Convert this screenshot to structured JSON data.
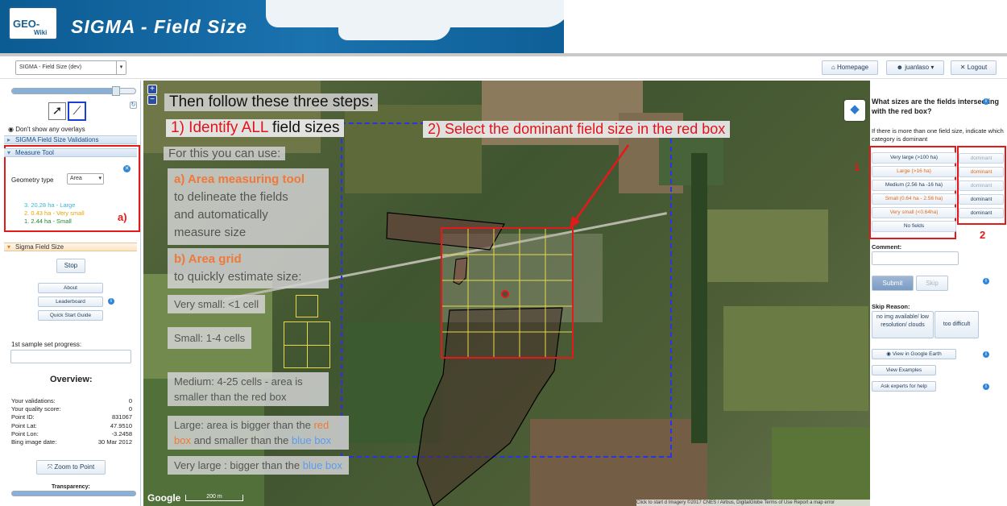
{
  "header": {
    "logo_top": "GEO-",
    "logo_bottom": "Wiki",
    "title": "SIGMA - Field Size"
  },
  "toolbar": {
    "project_select": "SIGMA - Field Size (dev)",
    "homepage": "Homepage",
    "user": "juanlaso",
    "logout": "Logout"
  },
  "left": {
    "overlay_option": "Don't show any overlays",
    "validations_header": "SIGMA Field Size Validations",
    "measure_header": "Measure Tool",
    "geometry_label": "Geometry type",
    "geometry_value": "Area",
    "measurements": [
      {
        "text": "3. 20.28 ha - Large",
        "color": "#35b5d8"
      },
      {
        "text": "2. 0.43 ha - Very small",
        "color": "#e7a300"
      },
      {
        "text": "1. 2.44 ha - Small",
        "color": "#1e8a2a"
      }
    ],
    "annot_a": "a)",
    "sigma_header": "Sigma Field Size",
    "stop": "Stop",
    "about": "About",
    "leaderboard": "Leaderboard",
    "quickstart": "Quick Start Guide",
    "progress_label": "1st sample set progress:",
    "overview_title": "Overview:",
    "stats": [
      {
        "k": "Your validations:",
        "v": "0"
      },
      {
        "k": "Your quality score:",
        "v": "0"
      },
      {
        "k": "Point ID:",
        "v": "831067"
      },
      {
        "k": "Point Lat:",
        "v": "47.9510"
      },
      {
        "k": "Point Lon:",
        "v": "-3.2458"
      },
      {
        "k": "Bing image date:",
        "v": "30 Mar 2012"
      }
    ],
    "zoom_btn": "Zoom to Point",
    "transparency": "Transparency:"
  },
  "map": {
    "step_title": "Then follow these three steps:",
    "step1_pre": "1) Identify ",
    "step1_hl": "ALL",
    "step1_post": " field sizes",
    "step2_pre": "2) Select the dominant field size in the ",
    "step2_hl": "red box",
    "use_label": "For this you can use:",
    "tool_a_title": "a) Area measuring tool",
    "tool_a_text1": "to delineate the fields",
    "tool_a_text2": "and automatically",
    "tool_a_text3": "measure size",
    "tool_b_title": "b) Area grid",
    "tool_b_text": "to quickly estimate size:",
    "vsmall": "Very small: <1  cell",
    "small": "Small: 1-4 cells",
    "medium1": "Medium:  4-25 cells - area is",
    "medium2": "smaller than the red box",
    "large_pre": "Large: area is bigger than the ",
    "large_red": "red",
    "large_red2": "box",
    "large_mid": " and smaller than the ",
    "large_blue": "blue box",
    "vlarge_pre": "Very large : bigger than the ",
    "vlarge_blue": "blue box",
    "google": "Google",
    "scale": "200 m",
    "footer_click": "Click to start d",
    "footer_imagery": "Imagery ©2017 CNES / Airbus, DigitalGlobe",
    "footer_terms": "Terms of Use",
    "footer_report": "Report a map error"
  },
  "right": {
    "question": "What sizes are the fields intersecting with the red box?",
    "hint": "If there is more than one field size, indicate which category is dominant",
    "categories": [
      {
        "label": "Very large (>100 ha)",
        "color": "#1f3b5a"
      },
      {
        "label": "Large (>16 ha)",
        "color": "#e06a1c"
      },
      {
        "label": "Medium (2.56 ha -16 ha)",
        "color": "#1f3b5a"
      },
      {
        "label": "Small (0.64 ha - 2.56 ha)",
        "color": "#e06a1c"
      },
      {
        "label": "Very small (<0.64ha)",
        "color": "#e06a1c"
      },
      {
        "label": "No fields",
        "color": "#1f3b5a"
      }
    ],
    "dominant": [
      {
        "label": "dominant",
        "color": "#9aaabb"
      },
      {
        "label": "dominant",
        "color": "#e06a1c"
      },
      {
        "label": "dominant",
        "color": "#9aaabb"
      },
      {
        "label": "dominant",
        "color": "#1f3b5a"
      },
      {
        "label": "dominant",
        "color": "#1f3b5a"
      }
    ],
    "annot1": "1",
    "annot2": "2",
    "comment_label": "Comment:",
    "submit": "Submit",
    "skip": "Skip",
    "skip_reason_label": "Skip Reason:",
    "skip_no_img": "no img available/ low resolution/ clouds",
    "skip_difficult": "too difficult",
    "google_earth": "View in Google Earth",
    "examples": "View Examples",
    "ask_experts": "Ask experts for help"
  }
}
